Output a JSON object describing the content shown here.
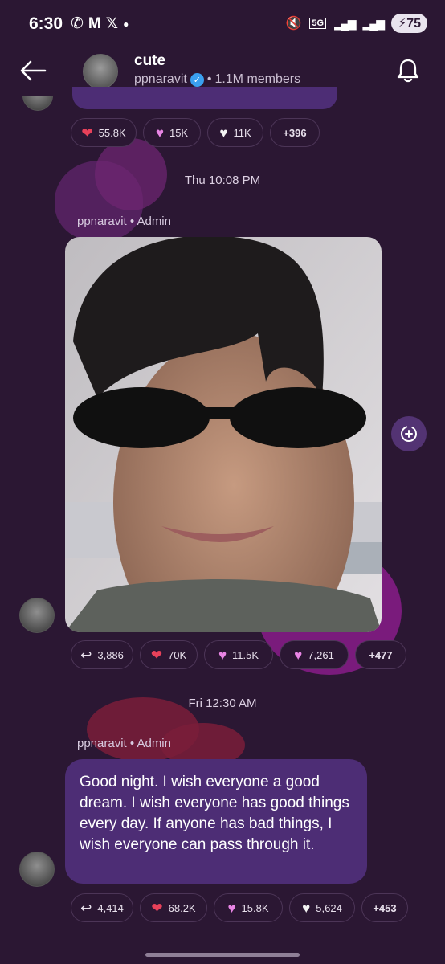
{
  "status_bar": {
    "time": "6:30",
    "notifications": [
      "whatsapp-icon",
      "gmail-icon",
      "x-icon"
    ],
    "network": "5G",
    "battery": "75"
  },
  "header": {
    "channel_name": "cute",
    "owner": "ppnaravit",
    "separator": "•",
    "members": "1.1M members"
  },
  "prev_post_reactions": [
    {
      "emoji": "❤",
      "color": "#e8415a",
      "count": "55.8K"
    },
    {
      "emoji": "♥",
      "color": "#e985e5",
      "count": "15K"
    },
    {
      "emoji": "♥",
      "color": "#f3f3f3",
      "count": "11K"
    },
    {
      "emoji": "",
      "color": "",
      "count": "+396"
    }
  ],
  "posts": [
    {
      "timestamp": "Thu 10:08 PM",
      "sender": "ppnaravit • Admin",
      "type": "photo",
      "reactions": [
        {
          "kind": "reply",
          "count": "3,886"
        },
        {
          "emoji": "❤",
          "color": "#e8415a",
          "count": "70K"
        },
        {
          "emoji": "♥",
          "color": "#e985e5",
          "count": "11.5K"
        },
        {
          "emoji": "♥",
          "color": "#e985e5",
          "count": "7,261"
        },
        {
          "kind": "more",
          "count": "+477"
        }
      ]
    },
    {
      "timestamp": "Fri 12:30 AM",
      "sender": "ppnaravit • Admin",
      "type": "text",
      "text": "Good night. I wish everyone a good dream. I wish everyone has good things every day. If anyone has bad things, I wish everyone can pass through it.",
      "reactions": [
        {
          "kind": "reply",
          "count": "4,414"
        },
        {
          "emoji": "❤",
          "color": "#e8415a",
          "count": "68.2K"
        },
        {
          "emoji": "♥",
          "color": "#e985e5",
          "count": "15.8K"
        },
        {
          "emoji": "♥",
          "color": "#f3f3f3",
          "count": "5,624"
        },
        {
          "kind": "more",
          "count": "+453"
        }
      ]
    }
  ]
}
